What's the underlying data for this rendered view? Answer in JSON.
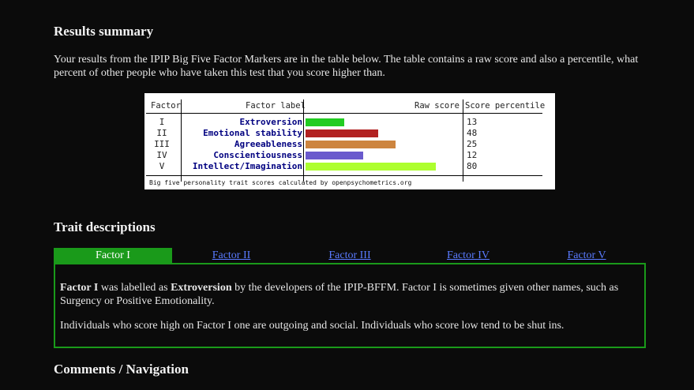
{
  "results": {
    "heading": "Results summary",
    "intro": "Your results from the IPIP Big Five Factor Markers are in the table below. The table contains a raw score and also a percentile, what percent of other people who have taken this test that you score higher than."
  },
  "score_table": {
    "headers": {
      "factor": "Factor",
      "label": "Factor label",
      "raw": "Raw score",
      "percentile": "Score percentile"
    },
    "rows": [
      {
        "num": "I",
        "label": "Extroversion",
        "percentile": "13",
        "color": "#22cc22"
      },
      {
        "num": "II",
        "label": "Emotional stability",
        "percentile": "48",
        "color": "#b22222"
      },
      {
        "num": "III",
        "label": "Agreeableness",
        "percentile": "25",
        "color": "#cd853f"
      },
      {
        "num": "IV",
        "label": "Conscientiousness",
        "percentile": "12",
        "color": "#6a5acd"
      },
      {
        "num": "V",
        "label": "Intellect/Imagination",
        "percentile": "80",
        "color": "#adff2f"
      }
    ],
    "raw_score_fraction": [
      0.25,
      0.47,
      0.58,
      0.37,
      0.84
    ],
    "caption": "Big five personality trait scores calculated by openpsychometrics.org"
  },
  "traits": {
    "heading": "Trait descriptions",
    "tabs": [
      "Factor I",
      "Factor II",
      "Factor III",
      "Factor IV",
      "Factor V"
    ],
    "active_tab": 0,
    "panel": {
      "p1_bold1": "Factor I",
      "p1_text1": " was labelled as ",
      "p1_bold2": "Extroversion",
      "p1_text2": " by the developers of the IPIP-BFFM. Factor I is sometimes given other names, such as Surgency or Positive Emotionality.",
      "p2": "Individuals who score high on Factor I one are outgoing and social. Individuals who score low tend to be shut ins."
    }
  },
  "comments": {
    "heading": "Comments / Navigation"
  },
  "colors": {
    "accent_green": "#1a9a1a",
    "link_blue": "#5a7bff",
    "background": "#0b0b0b"
  }
}
